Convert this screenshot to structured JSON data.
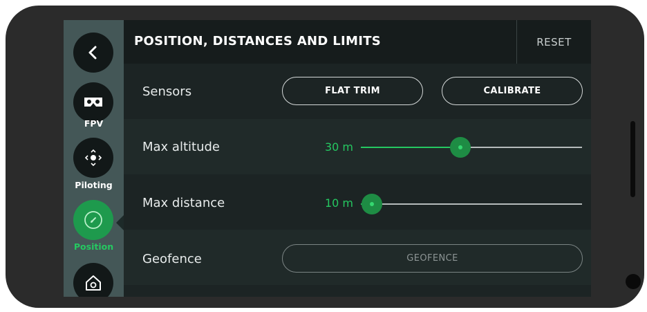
{
  "header": {
    "title": "POSITION, DISTANCES AND LIMITS",
    "reset_label": "RESET"
  },
  "nav": {
    "back_icon": "chevron-left-icon",
    "items": [
      {
        "id": "fpv",
        "label": "FPV",
        "icon": "vr-headset-icon",
        "active": false
      },
      {
        "id": "piloting",
        "label": "Piloting",
        "icon": "joystick-icon",
        "active": false
      },
      {
        "id": "position",
        "label": "Position",
        "icon": "compass-icon",
        "active": true
      },
      {
        "id": "home",
        "label": "",
        "icon": "home-icon",
        "active": false
      }
    ]
  },
  "rows": {
    "sensors": {
      "label": "Sensors",
      "flat_trim": "FLAT TRIM",
      "calibrate": "CALIBRATE"
    },
    "max_altitude": {
      "label": "Max altitude",
      "value": "30 m",
      "fraction": 0.45
    },
    "max_distance": {
      "label": "Max distance",
      "value": "10 m",
      "fraction": 0.05
    },
    "geofence": {
      "label": "Geofence",
      "button": "GEOFENCE",
      "enabled": false
    }
  },
  "colors": {
    "accent": "#25c861",
    "rail": "#445757",
    "background": "#1c2424",
    "header": "#161c1c"
  }
}
